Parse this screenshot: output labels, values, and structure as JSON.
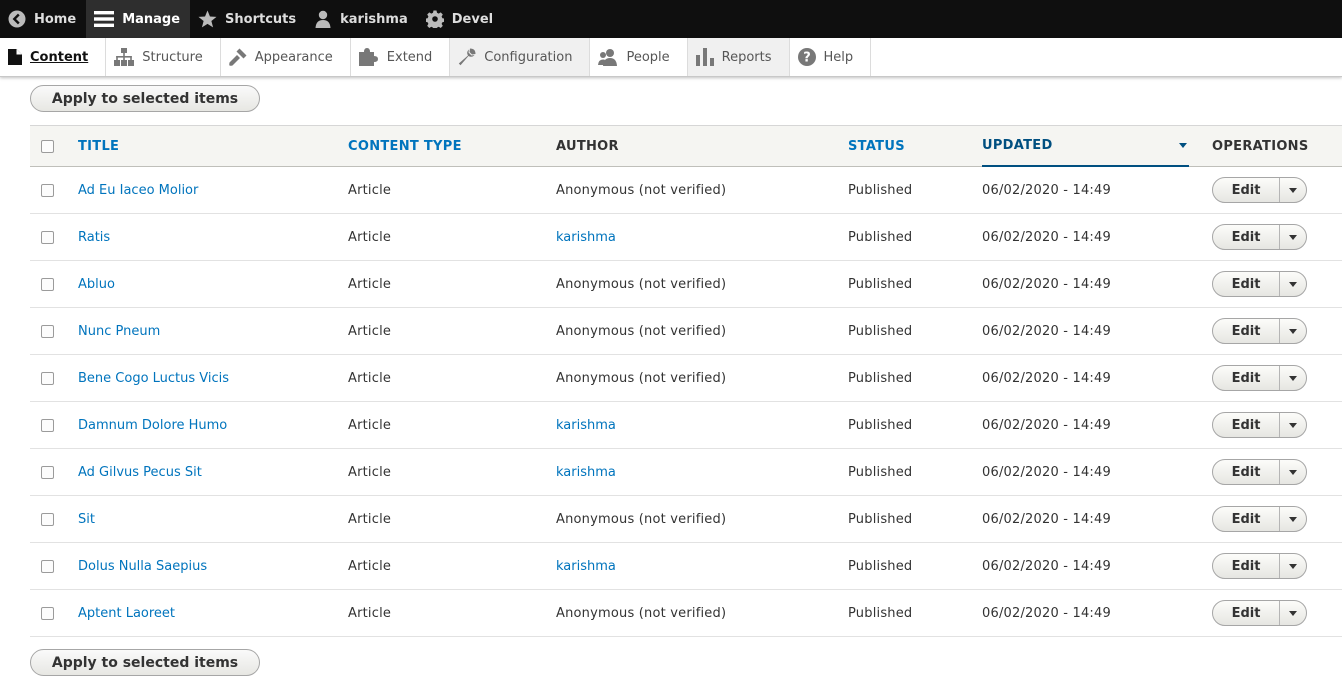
{
  "toolbar": {
    "items": [
      {
        "label": "Home",
        "icon": "back-arrow-icon"
      },
      {
        "label": "Manage",
        "icon": "hamburger-menu-icon"
      },
      {
        "label": "Shortcuts",
        "icon": "star-icon"
      },
      {
        "label": "karishma",
        "icon": "user-icon"
      },
      {
        "label": "Devel",
        "icon": "gear-icon"
      }
    ]
  },
  "tray": {
    "items": [
      {
        "label": "Content",
        "icon": "document-icon"
      },
      {
        "label": "Structure",
        "icon": "structure-icon"
      },
      {
        "label": "Appearance",
        "icon": "brush-icon"
      },
      {
        "label": "Extend",
        "icon": "puzzle-icon"
      },
      {
        "label": "Configuration",
        "icon": "wrench-icon"
      },
      {
        "label": "People",
        "icon": "people-icon"
      },
      {
        "label": "Reports",
        "icon": "bar-chart-icon"
      },
      {
        "label": "Help",
        "icon": "help-icon"
      }
    ]
  },
  "bulk": {
    "apply_label": "Apply to selected items"
  },
  "table": {
    "headers": {
      "title": "TITLE",
      "content_type": "CONTENT TYPE",
      "author": "AUTHOR",
      "status": "STATUS",
      "updated": "UPDATED",
      "operations": "OPERATIONS"
    },
    "edit_label": "Edit",
    "rows": [
      {
        "title": "Ad Eu Iaceo Molior",
        "type": "Article",
        "author": "Anonymous (not verified)",
        "author_link": false,
        "status": "Published",
        "updated": "06/02/2020 - 14:49"
      },
      {
        "title": "Ratis",
        "type": "Article",
        "author": "karishma",
        "author_link": true,
        "status": "Published",
        "updated": "06/02/2020 - 14:49"
      },
      {
        "title": "Abluo",
        "type": "Article",
        "author": "Anonymous (not verified)",
        "author_link": false,
        "status": "Published",
        "updated": "06/02/2020 - 14:49"
      },
      {
        "title": "Nunc Pneum",
        "type": "Article",
        "author": "Anonymous (not verified)",
        "author_link": false,
        "status": "Published",
        "updated": "06/02/2020 - 14:49"
      },
      {
        "title": "Bene Cogo Luctus Vicis",
        "type": "Article",
        "author": "Anonymous (not verified)",
        "author_link": false,
        "status": "Published",
        "updated": "06/02/2020 - 14:49"
      },
      {
        "title": "Damnum Dolore Humo",
        "type": "Article",
        "author": "karishma",
        "author_link": true,
        "status": "Published",
        "updated": "06/02/2020 - 14:49"
      },
      {
        "title": "Ad Gilvus Pecus Sit",
        "type": "Article",
        "author": "karishma",
        "author_link": true,
        "status": "Published",
        "updated": "06/02/2020 - 14:49"
      },
      {
        "title": "Sit",
        "type": "Article",
        "author": "Anonymous (not verified)",
        "author_link": false,
        "status": "Published",
        "updated": "06/02/2020 - 14:49"
      },
      {
        "title": "Dolus Nulla Saepius",
        "type": "Article",
        "author": "karishma",
        "author_link": true,
        "status": "Published",
        "updated": "06/02/2020 - 14:49"
      },
      {
        "title": "Aptent Laoreet",
        "type": "Article",
        "author": "Anonymous (not verified)",
        "author_link": false,
        "status": "Published",
        "updated": "06/02/2020 - 14:49"
      }
    ]
  },
  "colors": {
    "link": "#0074bd",
    "toolbar_bg": "#0f0f0f",
    "sorted_header": "#004f80"
  }
}
